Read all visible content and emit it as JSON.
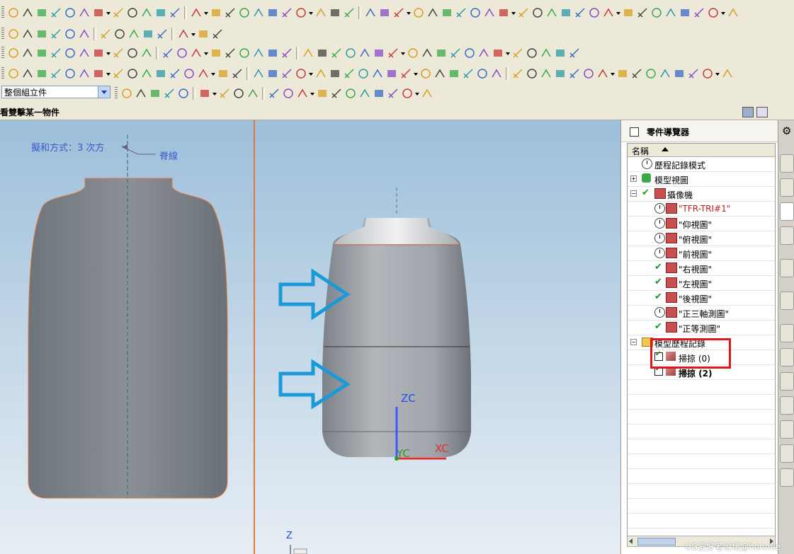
{
  "toolbar": {
    "assembly_filter": "整個組立件"
  },
  "selection_bar": {
    "hint": "看雙擊某一物件"
  },
  "viewport_left": {
    "note_text": "擬和方式：3 次方",
    "spine_label": "脊線"
  },
  "viewport_right": {
    "axis_zc": "ZC",
    "axis_yc": "YC",
    "axis_xc": "XC",
    "axis_z": "Z"
  },
  "navigator": {
    "title": "零件導覽器",
    "column_name": "名稱",
    "items": [
      {
        "label": "歷程記錄模式",
        "indent": 0
      },
      {
        "label": "模型視圖",
        "indent": 0
      },
      {
        "label": "攝像機",
        "indent": 0
      },
      {
        "label": "\"TFR-TRI#1\"",
        "indent": 1
      },
      {
        "label": "\"仰視圖\"",
        "indent": 1
      },
      {
        "label": "\"俯視圖\"",
        "indent": 1
      },
      {
        "label": "\"前視圖\"",
        "indent": 1
      },
      {
        "label": "\"右視圖\"",
        "indent": 1
      },
      {
        "label": "\"左視圖\"",
        "indent": 1
      },
      {
        "label": "\"後視圖\"",
        "indent": 1
      },
      {
        "label": "\"正三軸測圖\"",
        "indent": 1
      },
      {
        "label": "\"正等測圖\"",
        "indent": 1
      },
      {
        "label": "模型歷程記錄",
        "indent": 0
      },
      {
        "label": "掃掠 (0)",
        "indent": 1
      },
      {
        "label": "掃掠 (2)",
        "indent": 1
      }
    ]
  },
  "watermark": "UG爱好者论坛@honmle",
  "colors": {
    "accent_orange": "#e07a3c",
    "highlight_red": "#e0161c",
    "arrow_blue": "#1a9ad6",
    "check_green": "#1a9a2a"
  }
}
